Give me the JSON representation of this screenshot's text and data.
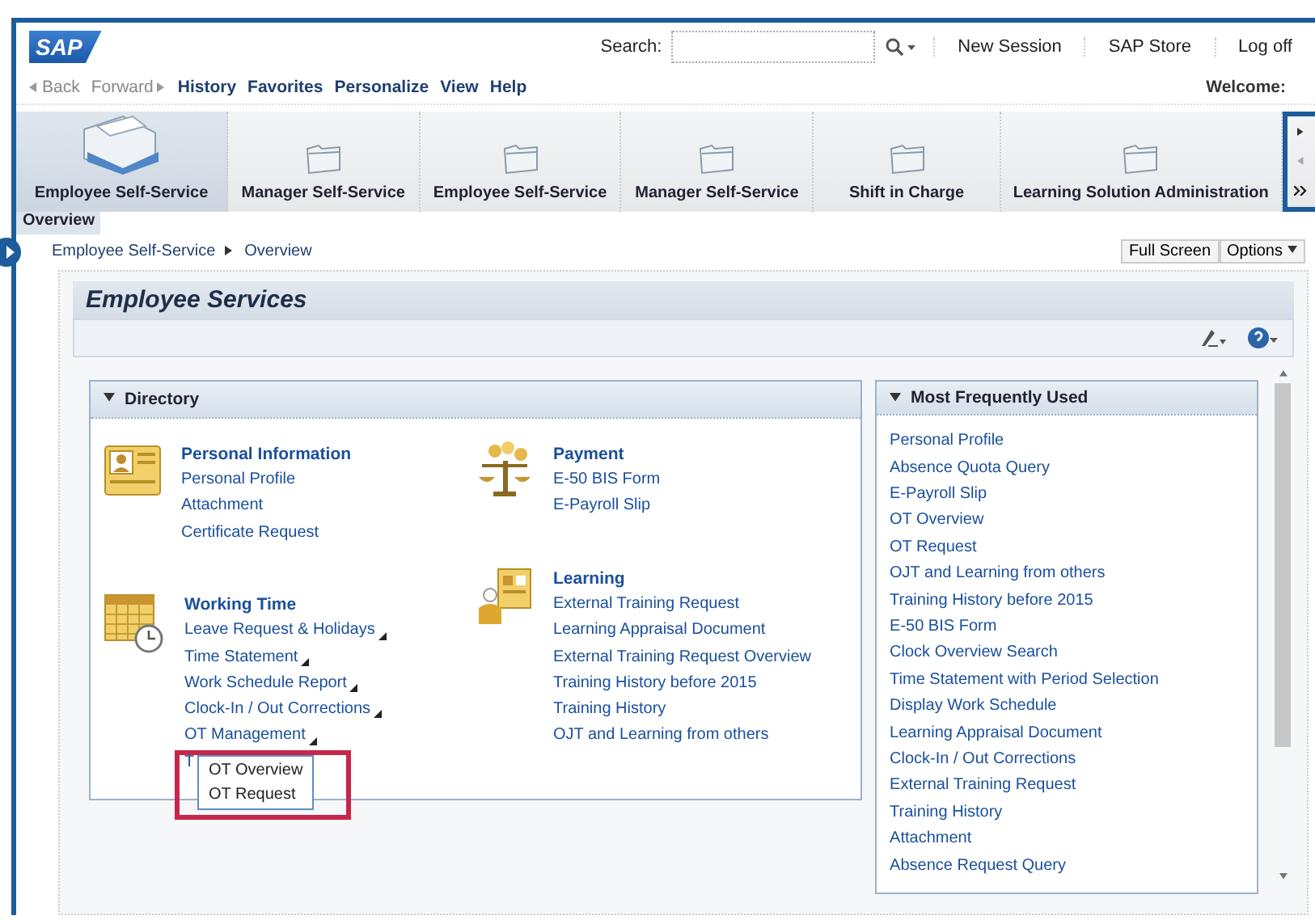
{
  "header": {
    "logo": "SAP",
    "search_label": "Search:",
    "links": [
      "New Session",
      "SAP Store",
      "Log off"
    ]
  },
  "nav": {
    "back": "Back",
    "forward": "Forward",
    "menus": [
      "History",
      "Favorites",
      "Personalize",
      "View",
      "Help"
    ],
    "welcome": "Welcome:"
  },
  "top_nav": [
    {
      "label": "Employee Self-Service",
      "selected": true
    },
    {
      "label": "Manager Self-Service",
      "selected": false
    },
    {
      "label": "Employee Self-Service",
      "selected": false
    },
    {
      "label": "Manager Self-Service",
      "selected": false
    },
    {
      "label": "Shift in Charge",
      "selected": false
    },
    {
      "label": "Learning Solution Administration",
      "selected": false
    }
  ],
  "sub_tabs": [
    {
      "label": "Overview",
      "selected": true
    }
  ],
  "breadcrumb": [
    "Employee Self-Service",
    "Overview"
  ],
  "page_actions": [
    "Full Screen",
    "Options"
  ],
  "page_title": "Employee Services",
  "directory": {
    "title": "Directory",
    "expanded": true,
    "columns": [
      [
        {
          "title": "Personal Information",
          "kind": "profile",
          "links": [
            {
              "label": "Personal Profile",
              "submenu": false
            },
            {
              "label": "Attachment",
              "submenu": false
            },
            {
              "label": "Certificate Request",
              "submenu": false
            }
          ]
        },
        {
          "title": "Working Time",
          "kind": "calendar",
          "links": [
            {
              "label": "Leave Request & Holidays",
              "submenu": true
            },
            {
              "label": "Time Statement",
              "submenu": true
            },
            {
              "label": "Work Schedule Report",
              "submenu": true
            },
            {
              "label": "Clock-In / Out Corrections",
              "submenu": true
            },
            {
              "label": "OT Management",
              "submenu": true,
              "menu": {
                "items": [
                  "OT Overview",
                  "OT Request"
                ],
                "highlighted": true
              }
            },
            {
              "label": "T",
              "submenu": false
            }
          ]
        }
      ],
      [
        {
          "title": "Payment",
          "kind": "scales",
          "links": [
            {
              "label": "E-50 BIS Form",
              "submenu": false
            },
            {
              "label": "E-Payroll Slip",
              "submenu": false
            }
          ]
        },
        {
          "title": "Learning",
          "kind": "learner",
          "links": [
            {
              "label": "External Training Request",
              "submenu": false
            },
            {
              "label": "Learning Appraisal Document",
              "submenu": false
            },
            {
              "label": "External Training Request Overview",
              "submenu": false
            },
            {
              "label": "Training History before 2015",
              "submenu": false
            },
            {
              "label": "Training History",
              "submenu": false
            },
            {
              "label": "OJT and Learning from others",
              "submenu": false
            }
          ]
        }
      ]
    ]
  },
  "most_used": {
    "title": "Most Frequently Used",
    "expanded": true,
    "links": [
      "Personal Profile",
      "Absence Quota Query",
      "E-Payroll Slip",
      "OT Overview",
      "OT Request",
      "OJT and Learning from others",
      "Training History before 2015",
      "E-50 BIS Form",
      "Clock Overview Search",
      "Time Statement with Period Selection",
      "Display Work Schedule",
      "Learning Appraisal Document",
      "Clock-In / Out Corrections",
      "External Training Request",
      "Training History",
      "Attachment",
      "Absence Request Query"
    ]
  }
}
